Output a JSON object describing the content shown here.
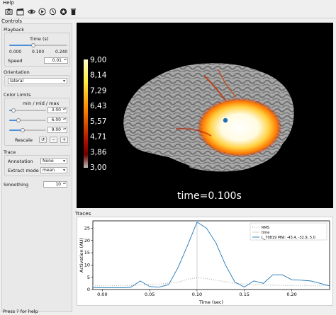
{
  "menu": {
    "help": "Help"
  },
  "toolbar": {
    "icons": [
      "screenshot-icon",
      "movie-icon",
      "visibility-icon",
      "play-icon",
      "reset-icon",
      "restore-icon",
      "trash-icon"
    ]
  },
  "controls": {
    "title": "Controls",
    "playback": {
      "title": "Playback",
      "time_label": "Time (s)",
      "time_fraction": 0.42,
      "tick_min": "0.000",
      "tick_mid": "0.100",
      "tick_max": "0.240",
      "speed_label": "Speed",
      "speed_value": "0.01"
    },
    "orientation": {
      "title": "Orientation",
      "value": "lateral"
    },
    "color_limits": {
      "title": "Color Limits",
      "subtitle": "min / mid / max",
      "min": "3.00",
      "mid": "6.00",
      "max": "9.00",
      "min_fraction": 0.12,
      "mid_fraction": 0.25,
      "max_fraction": 0.37,
      "rescale_label": "Rescale",
      "minus_label": "−",
      "plus_label": "+"
    },
    "trace": {
      "title": "Trace",
      "annotation_label": "Annotation",
      "annotation_value": "None",
      "extract_label": "Extract mode",
      "extract_value": "mean"
    },
    "smoothing": {
      "label": "Smoothing",
      "value": "10"
    }
  },
  "brain_view": {
    "time_text": "time=0.100s",
    "colorbar_ticks": [
      "9,00",
      "8,14",
      "7,29",
      "6,43",
      "5,57",
      "4,71",
      "3,86",
      "3,00"
    ]
  },
  "traces": {
    "title": "Traces"
  },
  "status": {
    "text": "Press ? for help"
  },
  "chart_data": {
    "type": "line",
    "title": "",
    "xlabel": "Time (sec)",
    "ylabel": "Activation (AU)",
    "xlim": [
      -0.01,
      0.24
    ],
    "ylim": [
      0,
      28
    ],
    "xticks": [
      "0.00",
      "0.05",
      "0.10",
      "0.15",
      "0.20"
    ],
    "yticks": [
      "0",
      "5",
      "10",
      "15",
      "20",
      "25"
    ],
    "legend_position": "top-right",
    "series": [
      {
        "name": "RMS",
        "color": "#bbbbbb",
        "style": "dotted",
        "x": [
          -0.01,
          0.0,
          0.02,
          0.04,
          0.06,
          0.08,
          0.09,
          0.1,
          0.11,
          0.12,
          0.14,
          0.16,
          0.18,
          0.2,
          0.22,
          0.24
        ],
        "y": [
          1.5,
          1.5,
          1.6,
          1.8,
          2.2,
          3.0,
          4.2,
          4.8,
          4.5,
          3.8,
          2.5,
          2.0,
          1.8,
          1.6,
          1.6,
          1.6
        ]
      },
      {
        "name": "time",
        "color": "#cccccc",
        "x": [
          0.1,
          0.1
        ],
        "y": [
          0,
          28
        ]
      },
      {
        "name": "L_70819  MNI: -43.4, -32.9,    5.0",
        "color": "#1f77b4",
        "x": [
          -0.01,
          0.0,
          0.02,
          0.03,
          0.04,
          0.05,
          0.06,
          0.07,
          0.08,
          0.09,
          0.1,
          0.11,
          0.12,
          0.13,
          0.14,
          0.15,
          0.16,
          0.17,
          0.18,
          0.19,
          0.2,
          0.21,
          0.22,
          0.23,
          0.24
        ],
        "y": [
          0.8,
          0.7,
          0.7,
          0.9,
          3.5,
          1.2,
          1.0,
          2.0,
          9.0,
          18.0,
          27.5,
          25.0,
          19.0,
          10.0,
          3.0,
          1.0,
          3.5,
          2.5,
          6.0,
          6.0,
          4.0,
          3.8,
          3.5,
          2.5,
          1.5
        ]
      }
    ]
  }
}
